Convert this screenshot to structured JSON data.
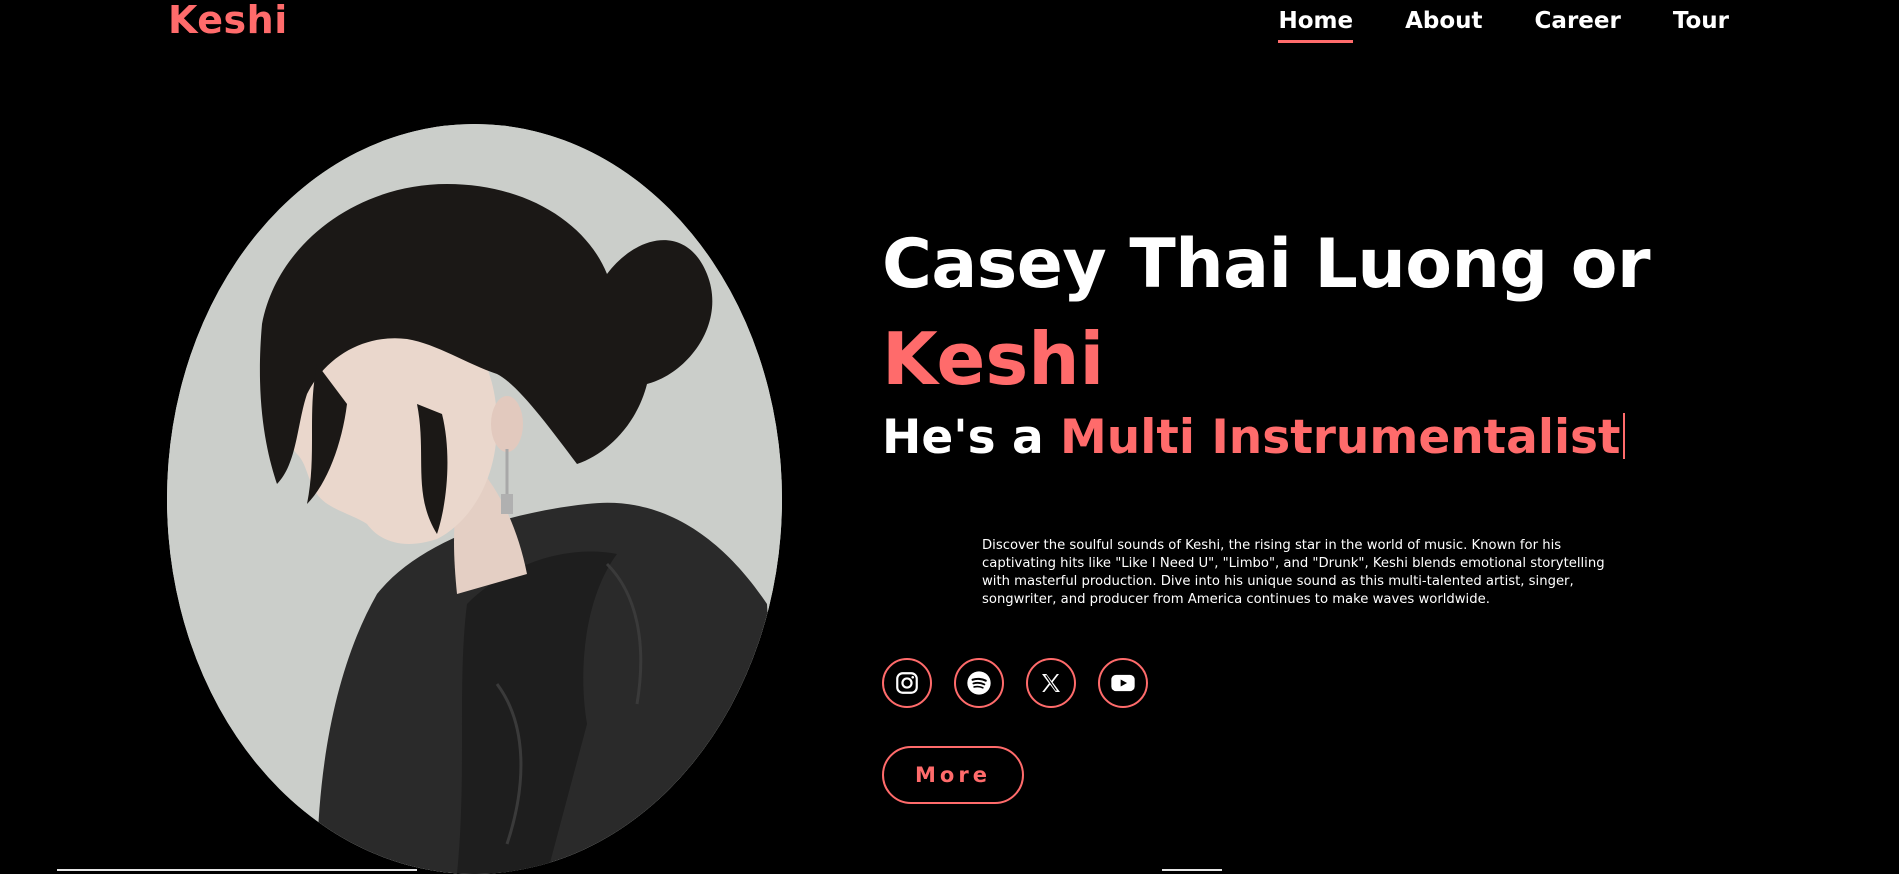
{
  "brand": {
    "logo": "Keshi",
    "accent_color": "#ff6b6b",
    "background": "#000000"
  },
  "nav": {
    "items": [
      {
        "label": "Home",
        "active": true
      },
      {
        "label": "About",
        "active": false
      },
      {
        "label": "Career",
        "active": false
      },
      {
        "label": "Tour",
        "active": false
      }
    ]
  },
  "hero": {
    "line1": "Casey Thai Luong or",
    "line2": "Keshi",
    "line3_prefix": "He's a ",
    "line3_accent": "Multi Instrumentalist",
    "description": "Discover the soulful sounds of Keshi, the rising star in the world of music. Known for his captivating hits like \"Like I Need U\", \"Limbo\", and \"Drunk\", Keshi blends emotional storytelling with masterful production. Dive into his unique sound as this multi-talented artist, singer, songwriter, and producer from America continues to make waves worldwide.",
    "more_label": "More"
  },
  "socials": [
    {
      "icon": "instagram-icon"
    },
    {
      "icon": "spotify-icon"
    },
    {
      "icon": "x-icon"
    },
    {
      "icon": "youtube-icon"
    }
  ]
}
